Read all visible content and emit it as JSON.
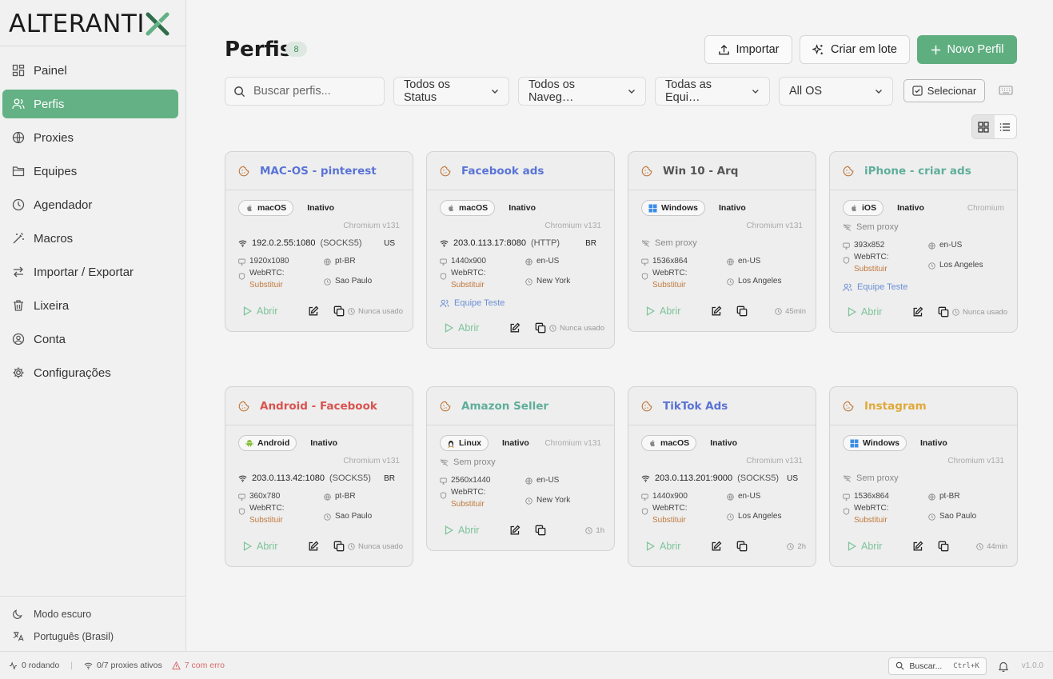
{
  "brand": {
    "logo_text": "ALTERANTI",
    "accent": "#63b184"
  },
  "sidebar": {
    "items": [
      {
        "label": "Painel",
        "icon": "dashboard-icon"
      },
      {
        "label": "Perfis",
        "icon": "users-icon",
        "active": true
      },
      {
        "label": "Proxies",
        "icon": "globe-icon"
      },
      {
        "label": "Equipes",
        "icon": "folder-icon"
      },
      {
        "label": "Agendador",
        "icon": "clock-icon"
      },
      {
        "label": "Macros",
        "icon": "wand-icon"
      },
      {
        "label": "Importar / Exportar",
        "icon": "swap-icon"
      },
      {
        "label": "Lixeira",
        "icon": "trash-icon"
      },
      {
        "label": "Conta",
        "icon": "user-circle-icon"
      },
      {
        "label": "Configurações",
        "icon": "gear-icon"
      }
    ],
    "dark_mode_label": "Modo escuro",
    "language_label": "Português (Brasil)"
  },
  "header": {
    "title": "Perfis",
    "count": "8",
    "import_label": "Importar",
    "batch_label": "Criar em lote",
    "new_label": "Novo Perfil"
  },
  "filters": {
    "search_placeholder": "Buscar perfis...",
    "status": "Todos os Status",
    "browser": "Todos os Naveg…",
    "team": "Todas as Equi…",
    "os": "All OS",
    "select_label": "Selecionar"
  },
  "cards": [
    {
      "title": "MAC-OS - pinterest",
      "color": "#5a73d6",
      "os": "macOS",
      "status": "Inativo",
      "browser": "Chromium v131",
      "browser_inline": false,
      "proxy": "192.0.2.55:1080",
      "proxy_type": "(SOCKS5)",
      "country": "US",
      "resolution": "1920x1080",
      "locale": "pt-BR",
      "webrtc": "WebRTC:",
      "webrtc_mode": "Substituir",
      "timezone": "Sao Paulo",
      "team": "",
      "open": "Abrir",
      "last_used": "Nunca usado"
    },
    {
      "title": "Facebook ads",
      "color": "#5a73d6",
      "os": "macOS",
      "status": "Inativo",
      "browser": "Chromium v131",
      "browser_inline": false,
      "proxy": "203.0.113.17:8080",
      "proxy_type": "(HTTP)",
      "country": "BR",
      "resolution": "1440x900",
      "locale": "en-US",
      "webrtc": "WebRTC:",
      "webrtc_mode": "Substituir",
      "timezone": "New York",
      "team": "Equipe Teste",
      "open": "Abrir",
      "last_used": "Nunca usado"
    },
    {
      "title": "Win 10 - Arq",
      "color": "#555555",
      "os": "Windows",
      "status": "Inativo",
      "browser": "Chromium v131",
      "browser_inline": false,
      "proxy": "",
      "no_proxy": "Sem proxy",
      "resolution": "1536x864",
      "locale": "en-US",
      "webrtc": "WebRTC:",
      "webrtc_mode": "Substituir",
      "timezone": "Los Angeles",
      "team": "",
      "open": "Abrir",
      "last_used": "45min"
    },
    {
      "title": "iPhone - criar ads",
      "color": "#5fae9a",
      "os": "iOS",
      "status": "Inativo",
      "browser": "Chromium",
      "browser_inline": true,
      "proxy": "",
      "no_proxy": "Sem proxy",
      "resolution": "393x852",
      "locale": "en-US",
      "webrtc": "WebRTC:",
      "webrtc_mode": "Substituir",
      "timezone": "Los Angeles",
      "team": "Equipe Teste",
      "open": "Abrir",
      "last_used": "Nunca usado"
    },
    {
      "title": "Android - Facebook",
      "color": "#d9534f",
      "os": "Android",
      "status": "Inativo",
      "browser": "Chromium v131",
      "browser_inline": false,
      "proxy": "203.0.113.42:1080",
      "proxy_type": "(SOCKS5)",
      "country": "BR",
      "resolution": "360x780",
      "locale": "pt-BR",
      "webrtc": "WebRTC:",
      "webrtc_mode": "Substituir",
      "timezone": "Sao Paulo",
      "team": "",
      "open": "Abrir",
      "last_used": "Nunca usado"
    },
    {
      "title": "Amazon Seller",
      "color": "#5fae9a",
      "os": "Linux",
      "status": "Inativo",
      "browser": "Chromium v131",
      "browser_inline": true,
      "proxy": "",
      "no_proxy": "Sem proxy",
      "resolution": "2560x1440",
      "locale": "en-US",
      "webrtc": "WebRTC:",
      "webrtc_mode": "Substituir",
      "timezone": "New York",
      "team": "",
      "open": "Abrir",
      "last_used": "1h"
    },
    {
      "title": "TikTok Ads",
      "color": "#5a73d6",
      "os": "macOS",
      "status": "Inativo",
      "browser": "Chromium v131",
      "browser_inline": false,
      "proxy": "203.0.113.201:9000",
      "proxy_type": "(SOCKS5)",
      "country": "US",
      "resolution": "1440x900",
      "locale": "en-US",
      "webrtc": "WebRTC:",
      "webrtc_mode": "Substituir",
      "timezone": "Los Angeles",
      "team": "",
      "open": "Abrir",
      "last_used": "2h"
    },
    {
      "title": "Instagram",
      "color": "#e0a93a",
      "os": "Windows",
      "status": "Inativo",
      "browser": "Chromium v131",
      "browser_inline": false,
      "proxy": "",
      "no_proxy": "Sem proxy",
      "resolution": "1536x864",
      "locale": "pt-BR",
      "webrtc": "WebRTC:",
      "webrtc_mode": "Substituir",
      "timezone": "Sao Paulo",
      "team": "",
      "open": "Abrir",
      "last_used": "44min"
    }
  ],
  "statusbar": {
    "running": "0 rodando",
    "proxies": "0/7 proxies ativos",
    "errors": "7 com erro",
    "search": "Buscar...",
    "shortcut": "Ctrl+K",
    "version": "v1.0.0"
  }
}
